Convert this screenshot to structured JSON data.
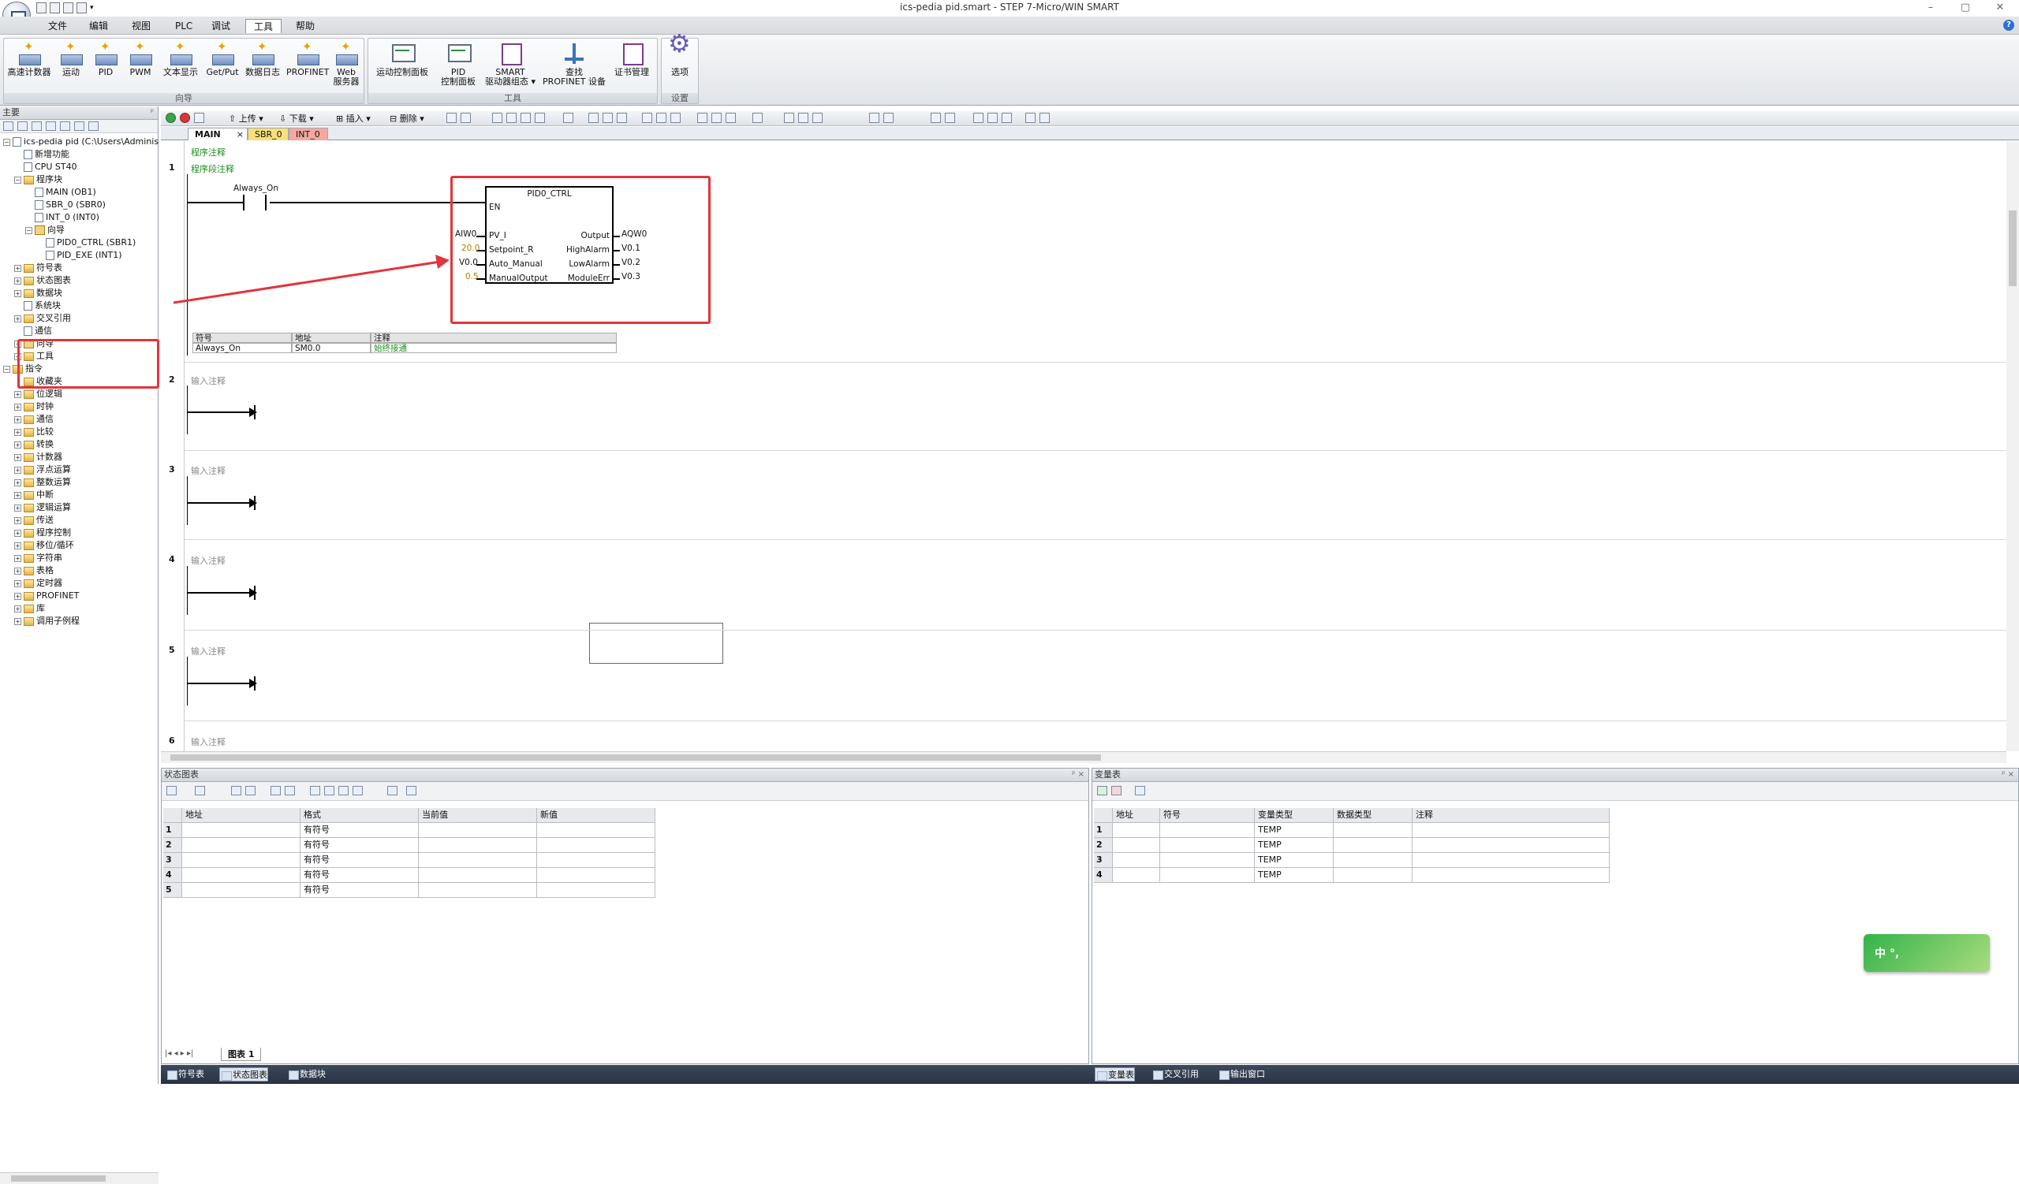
{
  "window": {
    "title": "ics-pedia pid.smart - STEP 7-Micro/WIN SMART",
    "controls": [
      "–",
      "▢",
      "✕"
    ]
  },
  "menu": [
    "文件",
    "编辑",
    "视图",
    "PLC",
    "调试",
    "工具",
    "帮助"
  ],
  "active_menu": "工具",
  "ribbon": {
    "groups": [
      {
        "label": "向导",
        "buttons": [
          "高速计数器",
          "运动",
          "PID",
          "PWM",
          "文本显示",
          "Get/Put",
          "数据日志",
          "PROFINET",
          "Web\n服务器"
        ]
      },
      {
        "label": "工具",
        "buttons": [
          "运动控制面板",
          "PID\n控制面板",
          "SMART\n驱动器组态 ▾",
          "查找\nPROFINET 设备",
          "证书管理"
        ]
      },
      {
        "label": "设置",
        "buttons": [
          "选项"
        ]
      }
    ]
  },
  "left_pane": {
    "title": "主要",
    "tree": [
      {
        "label": "ics-pedia pid (C:\\Users\\Administrator",
        "level": 0,
        "icon": "project",
        "toggle": "−"
      },
      {
        "label": "新增功能",
        "level": 1,
        "icon": "help"
      },
      {
        "label": "CPU ST40",
        "level": 1,
        "icon": "cpu"
      },
      {
        "label": "程序块",
        "level": 1,
        "icon": "folder",
        "toggle": "−"
      },
      {
        "label": "MAIN (OB1)",
        "level": 2,
        "icon": "page"
      },
      {
        "label": "SBR_0 (SBR0)",
        "level": 2,
        "icon": "page"
      },
      {
        "label": "INT_0 (INT0)",
        "level": 2,
        "icon": "page"
      },
      {
        "label": "向导",
        "level": 2,
        "icon": "wizard",
        "toggle": "−"
      },
      {
        "label": "PID0_CTRL (SBR1)",
        "level": 3,
        "icon": "page"
      },
      {
        "label": "PID_EXE (INT1)",
        "level": 3,
        "icon": "page"
      },
      {
        "label": "符号表",
        "level": 1,
        "icon": "folder",
        "toggle": "+"
      },
      {
        "label": "状态图表",
        "level": 1,
        "icon": "folder",
        "toggle": "+"
      },
      {
        "label": "数据块",
        "level": 1,
        "icon": "folder",
        "toggle": "+"
      },
      {
        "label": "系统块",
        "level": 1,
        "icon": "page"
      },
      {
        "label": "交叉引用",
        "level": 1,
        "icon": "folder",
        "toggle": "+"
      },
      {
        "label": "通信",
        "level": 1,
        "icon": "page"
      },
      {
        "label": "向导",
        "level": 1,
        "icon": "wizard",
        "toggle": "+"
      },
      {
        "label": "工具",
        "level": 1,
        "icon": "folder",
        "toggle": "+"
      },
      {
        "label": "指令",
        "level": 0,
        "icon": "folder",
        "toggle": "−"
      },
      {
        "label": "收藏夹",
        "level": 1,
        "icon": "folder"
      },
      {
        "label": "位逻辑",
        "level": 1,
        "icon": "folder",
        "toggle": "+"
      },
      {
        "label": "时钟",
        "level": 1,
        "icon": "folder",
        "toggle": "+"
      },
      {
        "label": "通信",
        "level": 1,
        "icon": "folder",
        "toggle": "+"
      },
      {
        "label": "比较",
        "level": 1,
        "icon": "folder",
        "toggle": "+"
      },
      {
        "label": "转换",
        "level": 1,
        "icon": "folder",
        "toggle": "+"
      },
      {
        "label": "计数器",
        "level": 1,
        "icon": "folder",
        "toggle": "+"
      },
      {
        "label": "浮点运算",
        "level": 1,
        "icon": "folder",
        "toggle": "+"
      },
      {
        "label": "整数运算",
        "level": 1,
        "icon": "folder",
        "toggle": "+"
      },
      {
        "label": "中断",
        "level": 1,
        "icon": "folder",
        "toggle": "+"
      },
      {
        "label": "逻辑运算",
        "level": 1,
        "icon": "folder",
        "toggle": "+"
      },
      {
        "label": "传送",
        "level": 1,
        "icon": "folder",
        "toggle": "+"
      },
      {
        "label": "程序控制",
        "level": 1,
        "icon": "folder",
        "toggle": "+"
      },
      {
        "label": "移位/循环",
        "level": 1,
        "icon": "folder",
        "toggle": "+"
      },
      {
        "label": "字符串",
        "level": 1,
        "icon": "folder",
        "toggle": "+"
      },
      {
        "label": "表格",
        "level": 1,
        "icon": "folder",
        "toggle": "+"
      },
      {
        "label": "定时器",
        "level": 1,
        "icon": "folder",
        "toggle": "+"
      },
      {
        "label": "PROFINET",
        "level": 1,
        "icon": "folder",
        "toggle": "+"
      },
      {
        "label": "库",
        "level": 1,
        "icon": "folder",
        "toggle": "+"
      },
      {
        "label": "调用子例程",
        "level": 1,
        "icon": "folder",
        "toggle": "+"
      }
    ]
  },
  "editor_toolbar": {
    "upload": "上传",
    "download": "下载",
    "insert": "插入",
    "delete": "删除"
  },
  "editor_tabs": [
    {
      "label": "MAIN",
      "close": "×"
    },
    {
      "label": "SBR_0"
    },
    {
      "label": "INT_0"
    }
  ],
  "program": {
    "program_comment": "程序注释",
    "networks": [
      {
        "number": "1",
        "comment": "程序段注释",
        "contact": "Always_On",
        "block": {
          "name": "PID0_CTRL",
          "en": "EN",
          "inputs": [
            {
              "pin": "PV_I",
              "value": "AIW0"
            },
            {
              "pin": "Setpoint_R",
              "value": "20.0"
            },
            {
              "pin": "Auto_Manual",
              "value": "V0.0"
            },
            {
              "pin": "ManualOutput",
              "value": "0.5"
            }
          ],
          "outputs": [
            {
              "pin": "Output",
              "value": "AQW0"
            },
            {
              "pin": "HighAlarm",
              "value": "V0.1"
            },
            {
              "pin": "LowAlarm",
              "value": "V0.2"
            },
            {
              "pin": "ModuleErr",
              "value": "V0.3"
            }
          ]
        },
        "symbol_table": {
          "headers": [
            "符号",
            "地址",
            "注释"
          ],
          "rows": [
            [
              "Always_On",
              "SM0.0",
              "始终接通"
            ]
          ]
        }
      },
      {
        "number": "2",
        "comment": "输入注释"
      },
      {
        "number": "3",
        "comment": "输入注释"
      },
      {
        "number": "4",
        "comment": "输入注释"
      },
      {
        "number": "5",
        "comment": "输入注释"
      },
      {
        "number": "6",
        "comment": "输入注释"
      }
    ]
  },
  "status_chart": {
    "title": "状态图表",
    "headers": [
      "地址",
      "格式",
      "当前值",
      "新值"
    ],
    "rows": [
      [
        "1",
        "",
        "有符号",
        "",
        ""
      ],
      [
        "2",
        "",
        "有符号",
        "",
        ""
      ],
      [
        "3",
        "",
        "有符号",
        "",
        ""
      ],
      [
        "4",
        "",
        "有符号",
        "",
        ""
      ],
      [
        "5",
        "",
        "有符号",
        "",
        ""
      ]
    ],
    "sheet_tab": "图表 1"
  },
  "variable_table": {
    "title": "变量表",
    "headers": [
      "地址",
      "符号",
      "变量类型",
      "数据类型",
      "注释"
    ],
    "rows": [
      [
        "1",
        "",
        "",
        "TEMP",
        "",
        ""
      ],
      [
        "2",
        "",
        "",
        "TEMP",
        "",
        ""
      ],
      [
        "3",
        "",
        "",
        "TEMP",
        "",
        ""
      ],
      [
        "4",
        "",
        "",
        "TEMP",
        "",
        ""
      ]
    ]
  },
  "bottom_tabs_left": [
    "符号表",
    "状态图表",
    "数据块"
  ],
  "bottom_tabs_right": [
    "变量表",
    "交叉引用",
    "输出窗口"
  ],
  "ime": {
    "text": "中 °,"
  }
}
